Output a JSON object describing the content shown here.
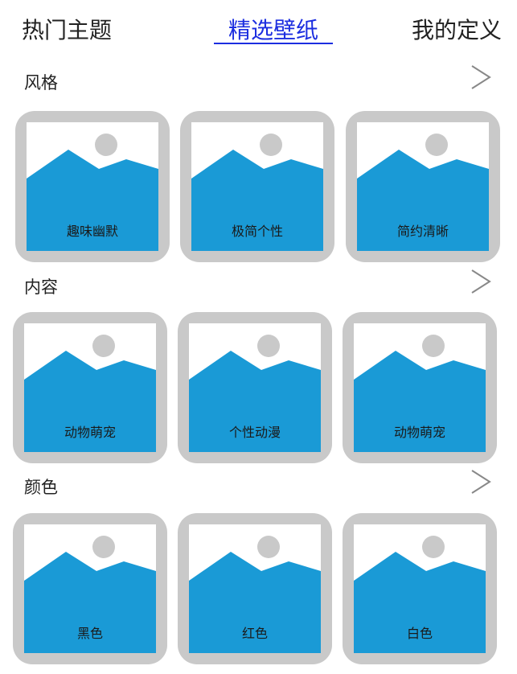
{
  "tabs": [
    {
      "label": "热门主题",
      "active": false
    },
    {
      "label": "精选壁纸",
      "active": true
    },
    {
      "label": "我的定义",
      "active": false
    }
  ],
  "colors": {
    "accent": "#1c2ee0",
    "card_border": "#c9c9c9",
    "mountain": "#1a9ad6",
    "sun": "#c9c9c9"
  },
  "sections": [
    {
      "title": "风格",
      "more_icon": "chevron-right-icon",
      "cards": [
        {
          "label": "趣味幽默",
          "icon": "image-placeholder-icon"
        },
        {
          "label": "极简个性",
          "icon": "image-placeholder-icon"
        },
        {
          "label": "简约清晰",
          "icon": "image-placeholder-icon"
        }
      ]
    },
    {
      "title": "内容",
      "more_icon": "chevron-right-icon",
      "cards": [
        {
          "label": "动物萌宠",
          "icon": "image-placeholder-icon"
        },
        {
          "label": "个性动漫",
          "icon": "image-placeholder-icon"
        },
        {
          "label": "动物萌宠",
          "icon": "image-placeholder-icon"
        }
      ]
    },
    {
      "title": "颜色",
      "more_icon": "chevron-right-icon",
      "cards": [
        {
          "label": "黑色",
          "icon": "image-placeholder-icon"
        },
        {
          "label": "红色",
          "icon": "image-placeholder-icon"
        },
        {
          "label": "白色",
          "icon": "image-placeholder-icon"
        }
      ]
    }
  ]
}
